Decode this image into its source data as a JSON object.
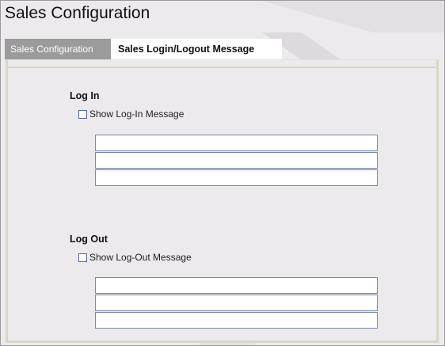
{
  "window": {
    "title": "Sales Configuration"
  },
  "tabs": [
    {
      "label": "Sales Configuration",
      "active": false
    },
    {
      "label": "Sales Login/Logout Message",
      "active": true
    }
  ],
  "login": {
    "heading": "Log In",
    "checkbox_label": "Show Log-In Message",
    "checked": false,
    "lines": [
      "",
      "",
      ""
    ]
  },
  "logout": {
    "heading": "Log Out",
    "checkbox_label": "Show Log-Out Message",
    "checked": false,
    "lines": [
      "",
      "",
      ""
    ]
  },
  "colors": {
    "inactive_tab": "#9b9b9b",
    "active_tab": "#ffffff",
    "panel_bg": "#eceaec",
    "input_border": "#7a86a6"
  }
}
